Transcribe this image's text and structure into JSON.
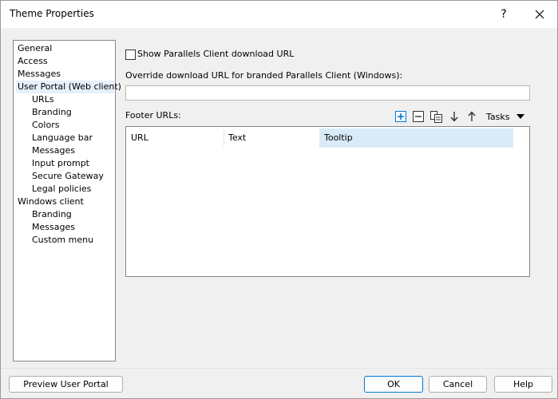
{
  "window": {
    "title": "Theme Properties",
    "help_glyph": "?"
  },
  "tree": {
    "items": [
      {
        "label": "General",
        "level": 0
      },
      {
        "label": "Access",
        "level": 0
      },
      {
        "label": "Messages",
        "level": 0
      },
      {
        "label": "User Portal (Web client)",
        "level": 0,
        "selected": true
      },
      {
        "label": "URLs",
        "level": 1
      },
      {
        "label": "Branding",
        "level": 1
      },
      {
        "label": "Colors",
        "level": 1
      },
      {
        "label": "Language bar",
        "level": 1
      },
      {
        "label": "Messages",
        "level": 1
      },
      {
        "label": "Input prompt",
        "level": 1
      },
      {
        "label": "Secure Gateway",
        "level": 1
      },
      {
        "label": "Legal policies",
        "level": 1
      },
      {
        "label": "Windows client",
        "level": 0
      },
      {
        "label": "Branding",
        "level": 1
      },
      {
        "label": "Messages",
        "level": 1
      },
      {
        "label": "Custom menu",
        "level": 1
      }
    ]
  },
  "main": {
    "show_download_label": "Show Parallels Client download URL",
    "show_download_checked": false,
    "override_label": "Override download URL for branded Parallels Client (Windows):",
    "override_value": "",
    "footer_label": "Footer URLs:",
    "tasks_label": "Tasks",
    "columns": [
      "URL",
      "Text",
      "Tooltip"
    ]
  },
  "buttons": {
    "preview": "Preview User Portal",
    "ok": "OK",
    "cancel": "Cancel",
    "help": "Help"
  },
  "colors": {
    "accent": "#0078d7",
    "selected_bg": "#e5f0fb",
    "column_highlight": "#d9ebf9"
  }
}
